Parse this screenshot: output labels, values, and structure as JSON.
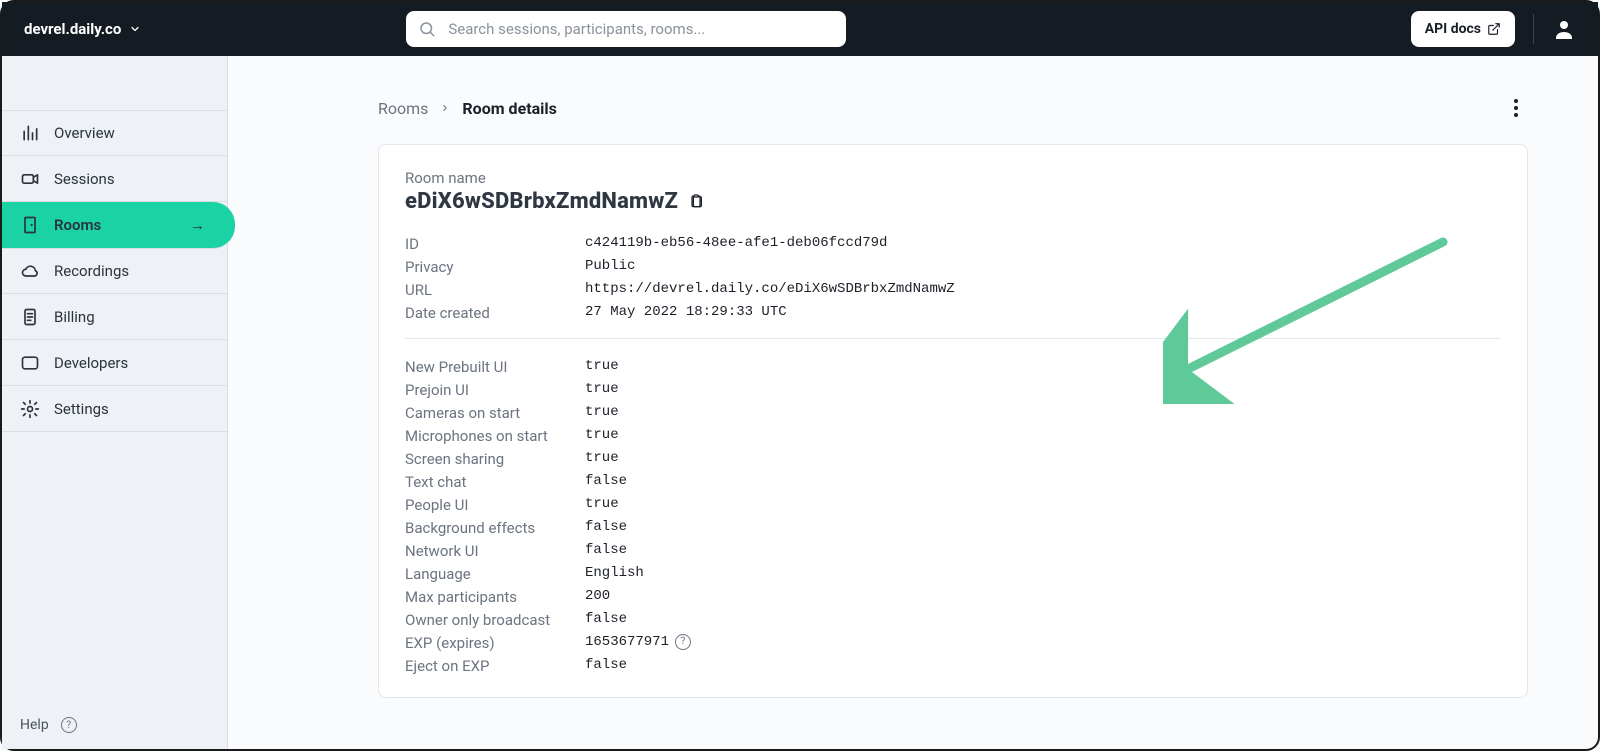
{
  "header": {
    "domain": "devrel.daily.co",
    "search_placeholder": "Search sessions, participants, rooms...",
    "api_docs": "API docs"
  },
  "sidebar": {
    "items": [
      {
        "label": "Overview",
        "icon": "bars"
      },
      {
        "label": "Sessions",
        "icon": "video"
      },
      {
        "label": "Rooms",
        "icon": "door",
        "active": true
      },
      {
        "label": "Recordings",
        "icon": "cloud"
      },
      {
        "label": "Billing",
        "icon": "receipt"
      },
      {
        "label": "Developers",
        "icon": "window"
      },
      {
        "label": "Settings",
        "icon": "gear"
      }
    ],
    "help": "Help"
  },
  "breadcrumb": {
    "root": "Rooms",
    "current": "Room details"
  },
  "room": {
    "name_label": "Room name",
    "name": "eDiX6wSDBrbxZmdNamwZ",
    "info": [
      {
        "k": "ID",
        "v": "c424119b-eb56-48ee-afe1-deb06fccd79d"
      },
      {
        "k": "Privacy",
        "v": "Public"
      },
      {
        "k": "URL",
        "v": "https://devrel.daily.co/eDiX6wSDBrbxZmdNamwZ"
      },
      {
        "k": "Date created",
        "v": "27 May 2022 18:29:33 UTC"
      }
    ],
    "props": [
      {
        "k": "New Prebuilt UI",
        "v": "true"
      },
      {
        "k": "Prejoin UI",
        "v": "true"
      },
      {
        "k": "Cameras on start",
        "v": "true"
      },
      {
        "k": "Microphones on start",
        "v": "true"
      },
      {
        "k": "Screen sharing",
        "v": "true"
      },
      {
        "k": "Text chat",
        "v": "false"
      },
      {
        "k": "People UI",
        "v": "true"
      },
      {
        "k": "Background effects",
        "v": "false"
      },
      {
        "k": "Network UI",
        "v": "false"
      },
      {
        "k": "Language",
        "v": "English"
      },
      {
        "k": "Max participants",
        "v": "200"
      },
      {
        "k": "Owner only broadcast",
        "v": "false"
      },
      {
        "k": "EXP (expires)",
        "v": "1653677971",
        "help": true
      },
      {
        "k": "Eject on EXP",
        "v": "false"
      }
    ]
  },
  "annotation": {
    "arrow_color": "#5fc99a"
  }
}
